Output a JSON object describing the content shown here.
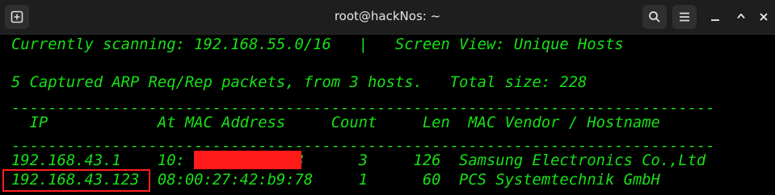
{
  "window": {
    "title": "root@hackNos: ~"
  },
  "scan": {
    "status_line": "Currently scanning: 192.168.55.0/16   |   Screen View: Unique Hosts",
    "summary_line": "5 Captured ARP Req/Rep packets, from 3 hosts.   Total size: 228",
    "separator": "-----------------------------------------------------------------------------",
    "columns": [
      "IP",
      "At MAC Address",
      "Count",
      "Len",
      "MAC Vendor / Hostname"
    ],
    "header_line": "  IP            At MAC Address     Count     Len  MAC Vendor / Hostname",
    "rows": [
      {
        "ip": "192.168.43.1",
        "mac": "10:          :f3",
        "count": "3",
        "len": "126",
        "vendor": "Samsung Electronics Co.,Ltd",
        "line": "192.168.43.1    10:          :f3      3     126  Samsung Electronics Co.,Ltd"
      },
      {
        "ip": "192.168.43.123",
        "mac": "08:00:27:42:b9:78",
        "count": "1",
        "len": "60",
        "vendor": "PCS Systemtechnik GmbH",
        "line": "192.168.43.123  08:00:27:42:b9:78     1      60  PCS Systemtechnik GmbH"
      }
    ]
  },
  "colors": {
    "terminal_text": "#17e017",
    "highlight": "#ff2020",
    "redaction": "#ff1a1a"
  }
}
